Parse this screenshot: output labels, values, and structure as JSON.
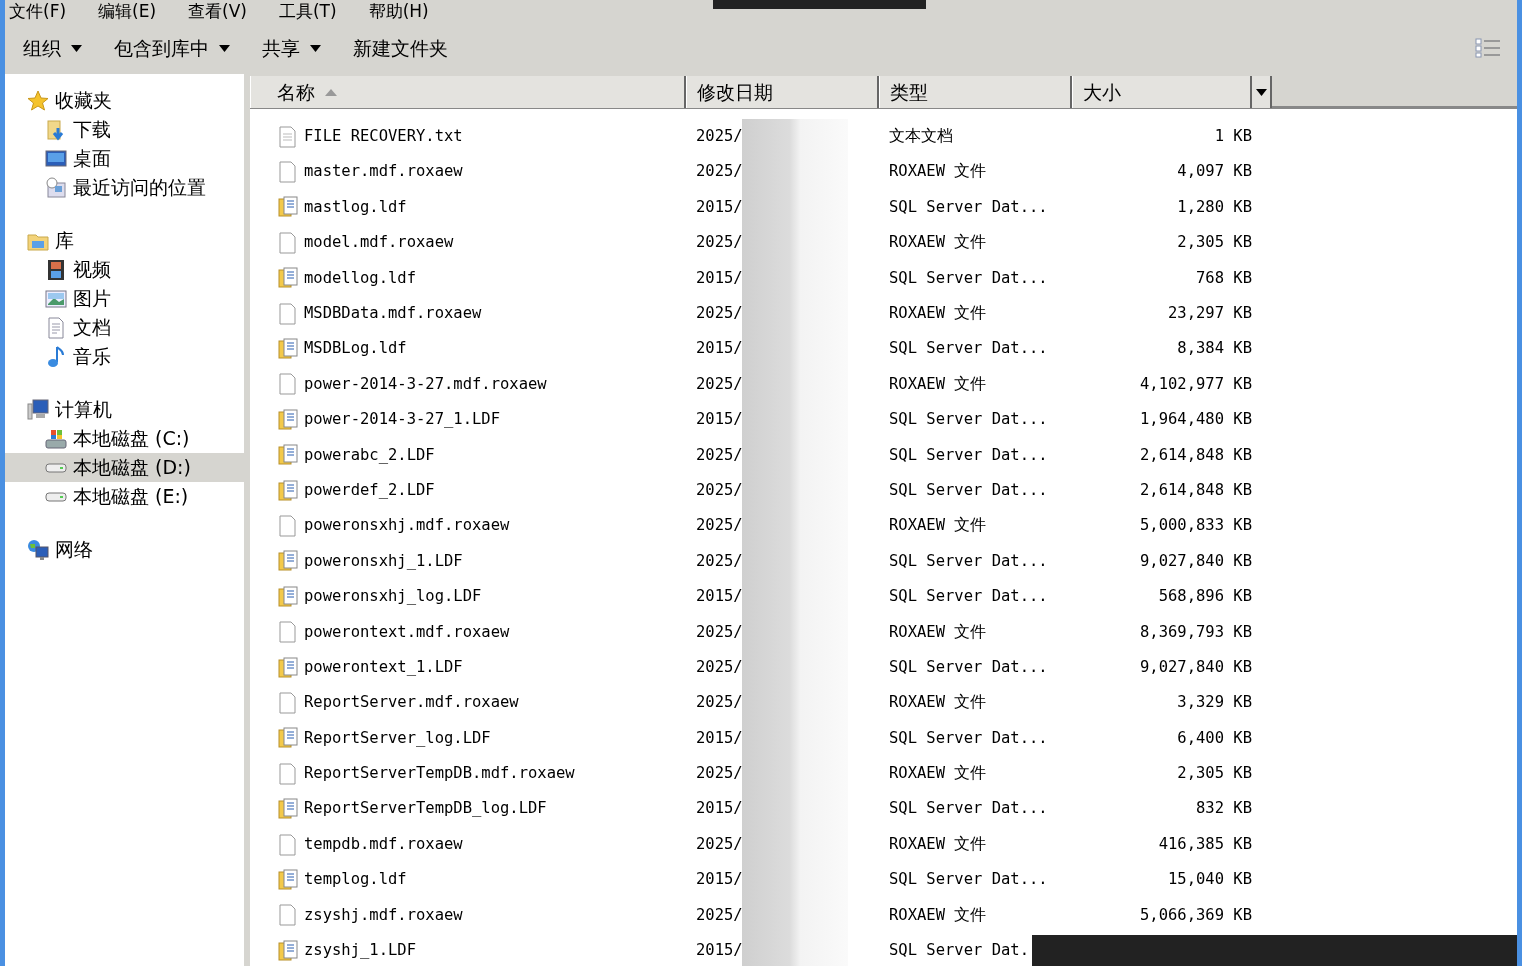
{
  "menu_bar": [
    "文件(F)",
    "编辑(E)",
    "查看(V)",
    "工具(T)",
    "帮助(H)"
  ],
  "toolbar": [
    {
      "label": "组织",
      "dropdown": true
    },
    {
      "label": "包含到库中",
      "dropdown": true
    },
    {
      "label": "共享",
      "dropdown": true
    },
    {
      "label": "新建文件夹",
      "dropdown": false
    }
  ],
  "sidebar": {
    "groups": [
      {
        "label": "收藏夹",
        "children": [
          {
            "label": "下载",
            "selected": false
          },
          {
            "label": "桌面",
            "selected": false
          },
          {
            "label": "最近访问的位置",
            "selected": false
          }
        ]
      },
      {
        "label": "库",
        "children": [
          {
            "label": "视频",
            "selected": false
          },
          {
            "label": "图片",
            "selected": false
          },
          {
            "label": "文档",
            "selected": false
          },
          {
            "label": "音乐",
            "selected": false
          }
        ]
      },
      {
        "label": "计算机",
        "children": [
          {
            "label": "本地磁盘 (C:)",
            "selected": false
          },
          {
            "label": "本地磁盘 (D:)",
            "selected": true
          },
          {
            "label": "本地磁盘 (E:)",
            "selected": false
          }
        ]
      },
      {
        "label": "网络"
      }
    ]
  },
  "table": {
    "columns": [
      "名称",
      "修改日期",
      "类型",
      "大小"
    ],
    "rows": [
      {
        "kind": "txt",
        "name": "FILE RECOVERY.txt",
        "date": "2025/",
        "type": "文本文档",
        "size": "1 KB"
      },
      {
        "kind": "file",
        "name": "master.mdf.roxaew",
        "date": "2025/",
        "type": "ROXAEW 文件",
        "size": "4,097 KB"
      },
      {
        "kind": "ldf",
        "name": "mastlog.ldf",
        "date": "2015/",
        "type": "SQL Server Dat...",
        "size": "1,280 KB"
      },
      {
        "kind": "file",
        "name": "model.mdf.roxaew",
        "date": "2025/",
        "type": "ROXAEW 文件",
        "size": "2,305 KB"
      },
      {
        "kind": "ldf",
        "name": "modellog.ldf",
        "date": "2015/",
        "type": "SQL Server Dat...",
        "size": "768 KB"
      },
      {
        "kind": "file",
        "name": "MSDBData.mdf.roxaew",
        "date": "2025/",
        "type": "ROXAEW 文件",
        "size": "23,297 KB"
      },
      {
        "kind": "ldf",
        "name": "MSDBLog.ldf",
        "date": "2015/",
        "type": "SQL Server Dat...",
        "size": "8,384 KB"
      },
      {
        "kind": "file",
        "name": "power-2014-3-27.mdf.roxaew",
        "date": "2025/",
        "type": "ROXAEW 文件",
        "size": "4,102,977 KB"
      },
      {
        "kind": "ldf",
        "name": "power-2014-3-27_1.LDF",
        "date": "2015/",
        "type": "SQL Server Dat...",
        "size": "1,964,480 KB"
      },
      {
        "kind": "ldf",
        "name": "powerabc_2.LDF",
        "date": "2025/",
        "type": "SQL Server Dat...",
        "size": "2,614,848 KB"
      },
      {
        "kind": "ldf",
        "name": "powerdef_2.LDF",
        "date": "2025/",
        "type": "SQL Server Dat...",
        "size": "2,614,848 KB"
      },
      {
        "kind": "file",
        "name": "poweronsxhj.mdf.roxaew",
        "date": "2025/",
        "type": "ROXAEW 文件",
        "size": "5,000,833 KB"
      },
      {
        "kind": "ldf",
        "name": "poweronsxhj_1.LDF",
        "date": "2025/",
        "type": "SQL Server Dat...",
        "size": "9,027,840 KB"
      },
      {
        "kind": "ldf",
        "name": "poweronsxhj_log.LDF",
        "date": "2015/",
        "type": "SQL Server Dat...",
        "size": "568,896 KB"
      },
      {
        "kind": "file",
        "name": "powerontext.mdf.roxaew",
        "date": "2025/",
        "type": "ROXAEW 文件",
        "size": "8,369,793 KB"
      },
      {
        "kind": "ldf",
        "name": "powerontext_1.LDF",
        "date": "2025/",
        "type": "SQL Server Dat...",
        "size": "9,027,840 KB"
      },
      {
        "kind": "file",
        "name": "ReportServer.mdf.roxaew",
        "date": "2025/",
        "type": "ROXAEW 文件",
        "size": "3,329 KB"
      },
      {
        "kind": "ldf",
        "name": "ReportServer_log.LDF",
        "date": "2015/",
        "type": "SQL Server Dat...",
        "size": "6,400 KB"
      },
      {
        "kind": "file",
        "name": "ReportServerTempDB.mdf.roxaew",
        "date": "2025/",
        "type": "ROXAEW 文件",
        "size": "2,305 KB"
      },
      {
        "kind": "ldf",
        "name": "ReportServerTempDB_log.LDF",
        "date": "2015/",
        "type": "SQL Server Dat...",
        "size": "832 KB"
      },
      {
        "kind": "file",
        "name": "tempdb.mdf.roxaew",
        "date": "2025/",
        "type": "ROXAEW 文件",
        "size": "416,385 KB"
      },
      {
        "kind": "ldf",
        "name": "templog.ldf",
        "date": "2015/",
        "type": "SQL Server Dat...",
        "size": "15,040 KB"
      },
      {
        "kind": "file",
        "name": "zsyshj.mdf.roxaew",
        "date": "2025/",
        "type": "ROXAEW 文件",
        "size": "5,066,369 KB"
      },
      {
        "kind": "ldf",
        "name": "zsyshj_1.LDF",
        "date": "2015/",
        "type": "SQL Server Dat."
      }
    ]
  }
}
